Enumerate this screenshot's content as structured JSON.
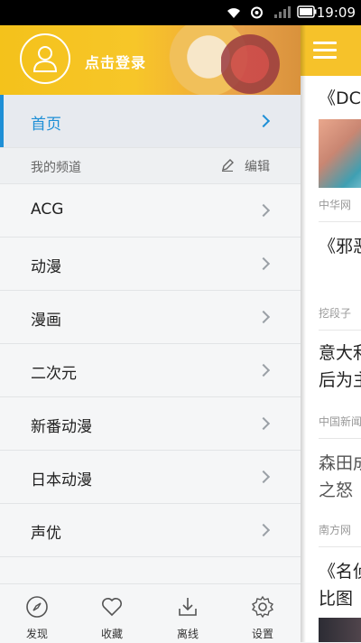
{
  "status_bar": {
    "time": "19:09"
  },
  "drawer": {
    "login_label": "点击登录",
    "home_label": "首页",
    "section_title": "我的频道",
    "edit_label": "编辑",
    "channels": [
      "ACG",
      "动漫",
      "漫画",
      "二次元",
      "新番动漫",
      "日本动漫",
      "声优"
    ]
  },
  "bottom_tabs": [
    "发现",
    "收藏",
    "离线",
    "设置"
  ],
  "feed": {
    "items": [
      {
        "title": "《DC",
        "source": "中华网"
      },
      {
        "title": "《邪恶",
        "source": "挖段子"
      },
      {
        "title_line1": "意大利",
        "title_line2": "后为主",
        "source": "中国新闻"
      },
      {
        "title_line1": "森田成",
        "title_line2": "之怒",
        "source": "南方网"
      },
      {
        "title_line1": "《名侦",
        "title_line2": "比图"
      }
    ]
  },
  "colors": {
    "accent": "#1e8fd6",
    "brand_yellow": "#f6c22a"
  }
}
